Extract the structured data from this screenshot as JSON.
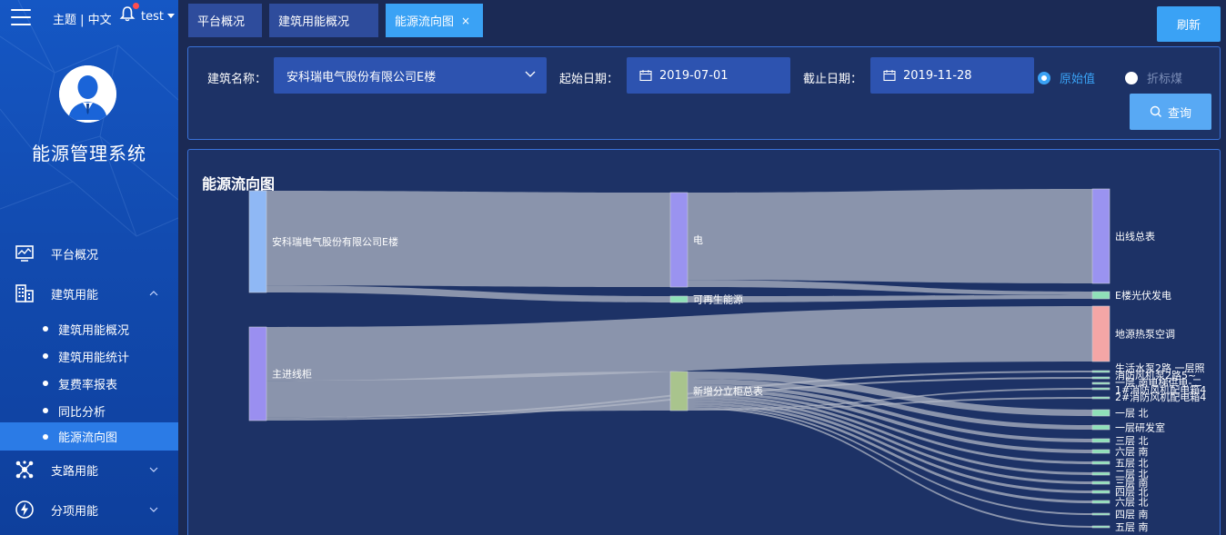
{
  "header": {
    "theme_label": "主题",
    "lang_label": "中文",
    "user_name": "test"
  },
  "sidebar": {
    "system_title": "能源管理系统",
    "menu": [
      {
        "label": "平台概况",
        "icon": "monitor-icon"
      },
      {
        "label": "建筑用能",
        "icon": "building-icon",
        "expanded": true
      },
      {
        "label": "支路用能",
        "icon": "network-icon"
      },
      {
        "label": "分项用能",
        "icon": "lightning-icon"
      }
    ],
    "submenu": [
      {
        "label": "建筑用能概况"
      },
      {
        "label": "建筑用能统计"
      },
      {
        "label": "复费率报表"
      },
      {
        "label": "同比分析"
      },
      {
        "label": "能源流向图",
        "active": true
      }
    ]
  },
  "tabs": [
    {
      "label": "平台概况"
    },
    {
      "label": "建筑用能概况"
    },
    {
      "label": "能源流向图",
      "active": true,
      "close": "×"
    }
  ],
  "toolbar": {
    "refresh_label": "刷新"
  },
  "filter": {
    "building_label": "建筑名称：",
    "building_value": "安科瑞电气股份有限公司E楼",
    "start_label": "起始日期：",
    "start_value": "2019-07-01",
    "end_label": "截止日期：",
    "end_value": "2019-11-28",
    "radio_original": "原始值",
    "radio_coal": "折标煤",
    "query_label": "查询"
  },
  "colors": {
    "sidebar": "#1557c4",
    "active": "#3aa2f5",
    "panel": "#1d3266",
    "background": "#1b2a55",
    "flow": "#b4bac8"
  },
  "chart": {
    "title": "能源流向图"
  },
  "chart_data": {
    "type": "sankey",
    "title": "能源流向图",
    "nodes": [
      {
        "name": "安科瑞电气股份有限公司E楼",
        "color": "#8fb8f5"
      },
      {
        "name": "主进线柜",
        "color": "#9a8ff0"
      },
      {
        "name": "电",
        "color": "#9a93f0"
      },
      {
        "name": "可再生能源",
        "color": "#8fe0b8"
      },
      {
        "name": "新增分立柜总表",
        "color": "#a9c48d"
      },
      {
        "name": "出线总表",
        "color": "#9a93f0"
      },
      {
        "name": "E楼光伏发电",
        "color": "#8fe0b8"
      },
      {
        "name": "地源热泵空调",
        "color": "#f4a6a6"
      },
      {
        "name": "生活水泵2路 一层照",
        "color": "#8fe0b8"
      },
      {
        "name": "消防风机泵2路5~",
        "color": "#8fe0b8"
      },
      {
        "name": "1#消防风机配电箱4",
        "color": "#8fe0b8"
      },
      {
        "name": "一层 南电梯供电-二",
        "color": "#8fe0b8"
      },
      {
        "name": "2#消防风机配电箱4",
        "color": "#8fe0b8"
      },
      {
        "name": "一层 北",
        "color": "#8fe0b8"
      },
      {
        "name": "一层研发室",
        "color": "#8fe0b8"
      },
      {
        "name": "三层 北",
        "color": "#8fe0b8"
      },
      {
        "name": "六层 南",
        "color": "#8fe0b8"
      },
      {
        "name": "五层 北",
        "color": "#8fe0b8"
      },
      {
        "name": "二层 北",
        "color": "#8fe0b8"
      },
      {
        "name": "三层 南",
        "color": "#8fe0b8"
      },
      {
        "name": "四层 北",
        "color": "#8fe0b8"
      },
      {
        "name": "六层 北",
        "color": "#8fe0b8"
      },
      {
        "name": "四层 南",
        "color": "#8fe0b8"
      },
      {
        "name": "五层 南",
        "color": "#8fe0b8"
      }
    ],
    "links": [
      {
        "source": "安科瑞电气股份有限公司E楼",
        "target": "电",
        "value": 108
      },
      {
        "source": "安科瑞电气股份有限公司E楼",
        "target": "可再生能源",
        "value": 8
      },
      {
        "source": "电",
        "target": "出线总表",
        "value": 100
      },
      {
        "source": "电",
        "target": "E楼光伏发电",
        "value": 8
      },
      {
        "source": "可再生能源",
        "target": "E楼光伏发电",
        "value": 8
      },
      {
        "source": "主进线柜",
        "target": "地源热泵空调",
        "value": 62
      },
      {
        "source": "主进线柜",
        "target": "新增分立柜总表",
        "value": 42
      },
      {
        "source": "主进线柜",
        "target": "生活水泵2路 一层照",
        "value": 2
      },
      {
        "source": "主进线柜",
        "target": "消防风机泵2路5~",
        "value": 2
      },
      {
        "source": "新增分立柜总表",
        "target": "一层 北",
        "value": 8
      },
      {
        "source": "新增分立柜总表",
        "target": "一层研发室",
        "value": 6
      },
      {
        "source": "新增分立柜总表",
        "target": "三层 北",
        "value": 4
      },
      {
        "source": "新增分立柜总表",
        "target": "六层 南",
        "value": 4
      },
      {
        "source": "新增分立柜总表",
        "target": "五层 北",
        "value": 3
      },
      {
        "source": "新增分立柜总表",
        "target": "二层 北",
        "value": 3
      },
      {
        "source": "新增分立柜总表",
        "target": "三层 南",
        "value": 3
      },
      {
        "source": "新增分立柜总表",
        "target": "四层 北",
        "value": 3
      },
      {
        "source": "新增分立柜总表",
        "target": "六层 北",
        "value": 3
      },
      {
        "source": "新增分立柜总表",
        "target": "四层 南",
        "value": 2
      },
      {
        "source": "新增分立柜总表",
        "target": "五层 南",
        "value": 2
      },
      {
        "source": "新增分立柜总表",
        "target": "1#消防风机配电箱4",
        "value": 1
      },
      {
        "source": "新增分立柜总表",
        "target": "2#消防风机配电箱4",
        "value": 1
      }
    ]
  }
}
